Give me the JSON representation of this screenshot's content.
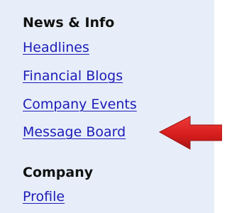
{
  "sidebar": {
    "sections": [
      {
        "heading": "News & Info",
        "links": [
          "Headlines",
          "Financial Blogs",
          "Company Events",
          "Message Board"
        ]
      },
      {
        "heading": "Company",
        "links": [
          "Profile"
        ]
      }
    ]
  },
  "colors": {
    "panel_background": "#e7eef9",
    "link": "#1c1cb8",
    "heading": "#111111",
    "arrow": "#d81e1e"
  },
  "icons": {
    "pointer": "red-arrow-icon"
  }
}
